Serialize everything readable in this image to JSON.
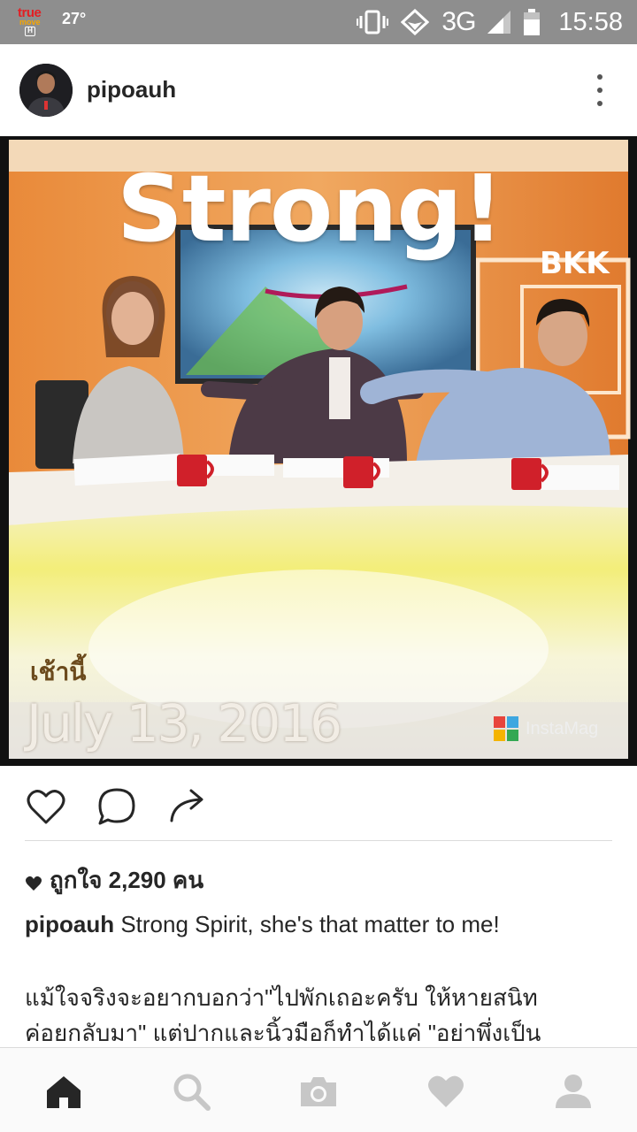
{
  "status_bar": {
    "carrier_top": "true",
    "carrier_bottom": "move",
    "carrier_badge": "H",
    "temperature": "27°",
    "network": "3G",
    "time": "15:58"
  },
  "post": {
    "username": "pipoauh",
    "photo": {
      "headline": "Strong!",
      "corner_tag": "BKK",
      "thai_label": "เช้านี้",
      "date_stamp": "July 13, 2016",
      "watermark": "InstaMag"
    },
    "likes_text": "ถูกใจ 2,290 คน",
    "caption_user": "pipoauh",
    "caption_text": "Strong Spirit, she's that matter to me!",
    "caption_body_line1": "แม้ใจจริงจะอยากบอกว่า\"ไปพักเถอะครับ  ให้หายสนิท",
    "caption_body_line2": "ค่อยกลับมา\" แต่ปากและนิ้วมือก็ทำได้แค่ \"อย่าพึ่งเป็น"
  },
  "icons": {
    "like": "heart-outline-icon",
    "comment": "comment-bubble-icon",
    "share": "share-arrow-icon",
    "nav": [
      "home-icon",
      "search-icon",
      "camera-icon",
      "heart-icon",
      "profile-icon"
    ]
  },
  "colors": {
    "status_bar": "#8e8e8e",
    "text": "#262626",
    "icon_gray": "#c7c7c7",
    "icon_dark": "#262626"
  }
}
